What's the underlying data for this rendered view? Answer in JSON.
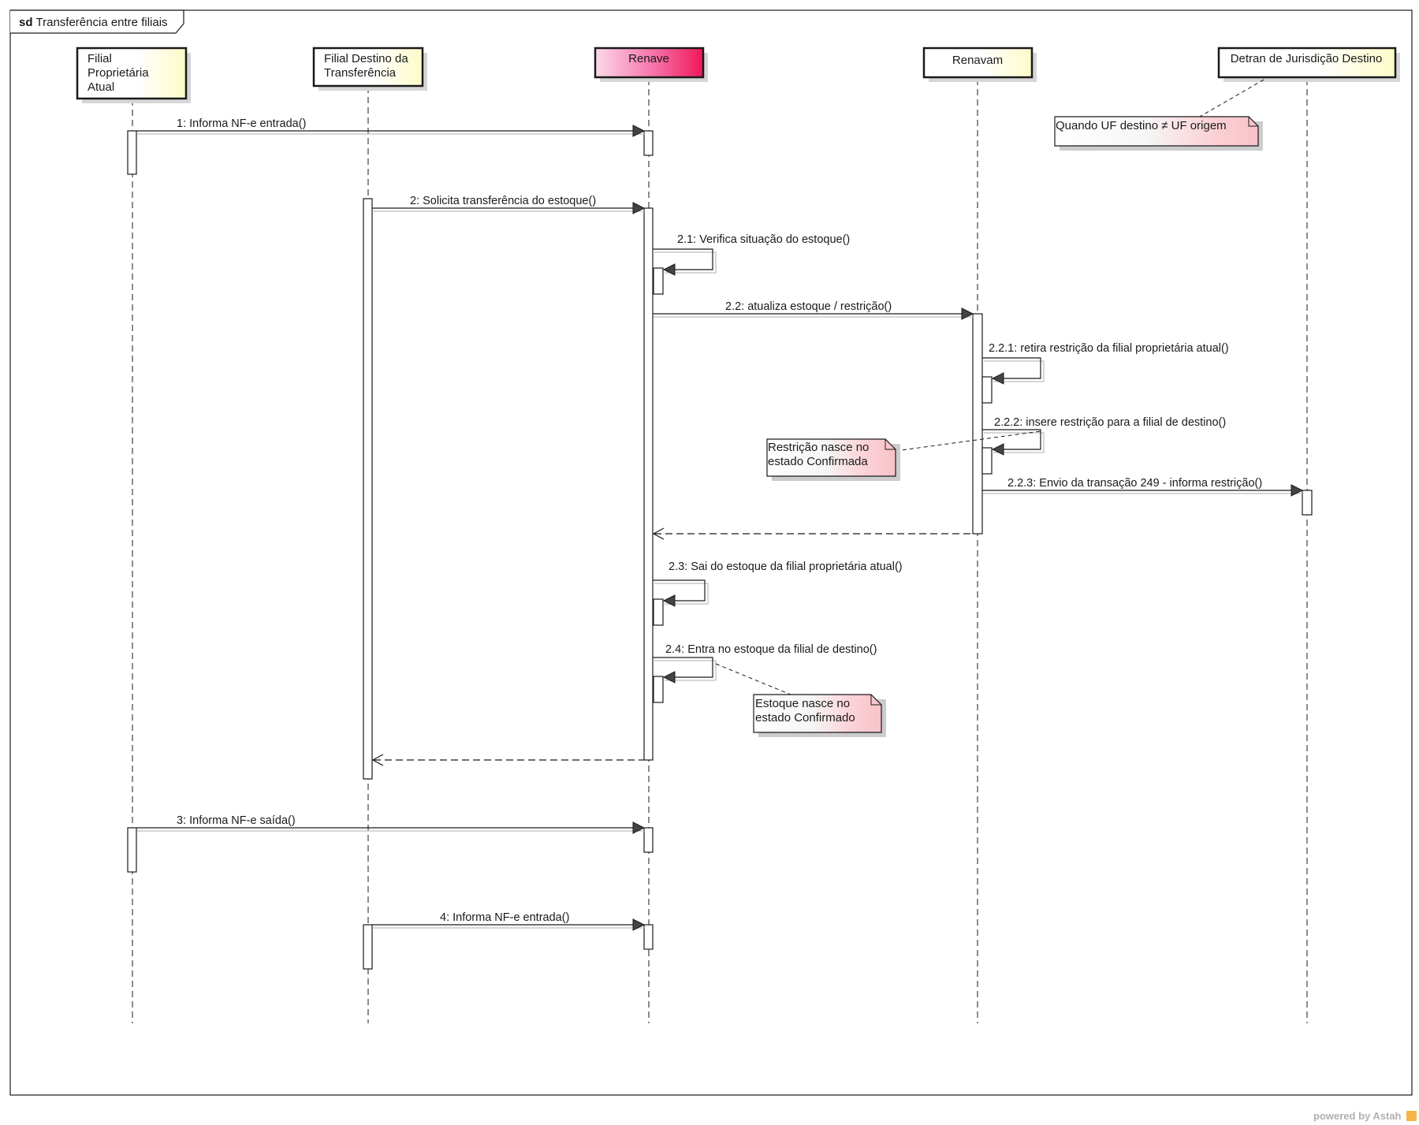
{
  "frame": {
    "keyword": "sd",
    "title": "Transferência entre filiais"
  },
  "lifelines": [
    {
      "id": "filial_proprietaria",
      "lines": [
        "Filial",
        "Proprietária",
        "Atual"
      ],
      "fill": "#fefed6"
    },
    {
      "id": "filial_destino",
      "lines": [
        "Filial Destino da",
        "Transferência"
      ],
      "fill": "#fefed6"
    },
    {
      "id": "renave",
      "lines": [
        "Renave"
      ],
      "fill": "#f5247e"
    },
    {
      "id": "renavam",
      "lines": [
        "Renavam"
      ],
      "fill": "#fefed6"
    },
    {
      "id": "detran",
      "lines": [
        "Detran de Jurisdição Destino"
      ],
      "fill": "#fefed6"
    }
  ],
  "messages": [
    {
      "id": "m1",
      "label": "1: Informa NF-e entrada()",
      "from": "filial_proprietaria",
      "to": "renave",
      "type": "sync"
    },
    {
      "id": "m2",
      "label": "2: Solicita transferência do estoque()",
      "from": "filial_destino",
      "to": "renave",
      "type": "sync"
    },
    {
      "id": "m21",
      "label": "2.1: Verifica situação do estoque()",
      "from": "renave",
      "to": "renave",
      "type": "self"
    },
    {
      "id": "m22",
      "label": "2.2: atualiza estoque / restrição()",
      "from": "renave",
      "to": "renavam",
      "type": "sync"
    },
    {
      "id": "m221",
      "label": "2.2.1: retira restrição da filial proprietária atual()",
      "from": "renavam",
      "to": "renavam",
      "type": "self"
    },
    {
      "id": "m222",
      "label": "2.2.2: insere restrição para a filial de destino()",
      "from": "renavam",
      "to": "renavam",
      "type": "self"
    },
    {
      "id": "m223",
      "label": "2.2.3: Envio da transação 249 - informa restrição()",
      "from": "renavam",
      "to": "detran",
      "type": "sync"
    },
    {
      "id": "r22",
      "label": "",
      "from": "renavam",
      "to": "renave",
      "type": "return"
    },
    {
      "id": "m23",
      "label": "2.3: Sai do estoque da filial proprietária atual()",
      "from": "renave",
      "to": "renave",
      "type": "self"
    },
    {
      "id": "m24",
      "label": "2.4: Entra no estoque da filial de destino()",
      "from": "renave",
      "to": "renave",
      "type": "self"
    },
    {
      "id": "r2",
      "label": "",
      "from": "renave",
      "to": "filial_destino",
      "type": "return"
    },
    {
      "id": "m3",
      "label": "3: Informa NF-e saída()",
      "from": "filial_proprietaria",
      "to": "renave",
      "type": "sync"
    },
    {
      "id": "m4",
      "label": "4: Informa NF-e entrada()",
      "from": "filial_destino",
      "to": "renave",
      "type": "sync"
    }
  ],
  "notes": [
    {
      "id": "note_uf",
      "lines": [
        "Quando UF destino ≠  UF origem"
      ],
      "attached_to": "detran"
    },
    {
      "id": "note_restricao",
      "lines": [
        "Restrição nasce no",
        "estado Confirmada"
      ],
      "attached_to": "m222"
    },
    {
      "id": "note_estoque",
      "lines": [
        "Estoque nasce no",
        "estado Confirmado"
      ],
      "attached_to": "m24"
    }
  ],
  "footer": {
    "text": "powered by Astah"
  },
  "colors": {
    "lifeline_fill": "#fefed6",
    "renave_fill": "#f5247e",
    "note_fill": "#fbd3d8",
    "line": "#1a1a1a",
    "shadow": "#c8c8c8"
  }
}
